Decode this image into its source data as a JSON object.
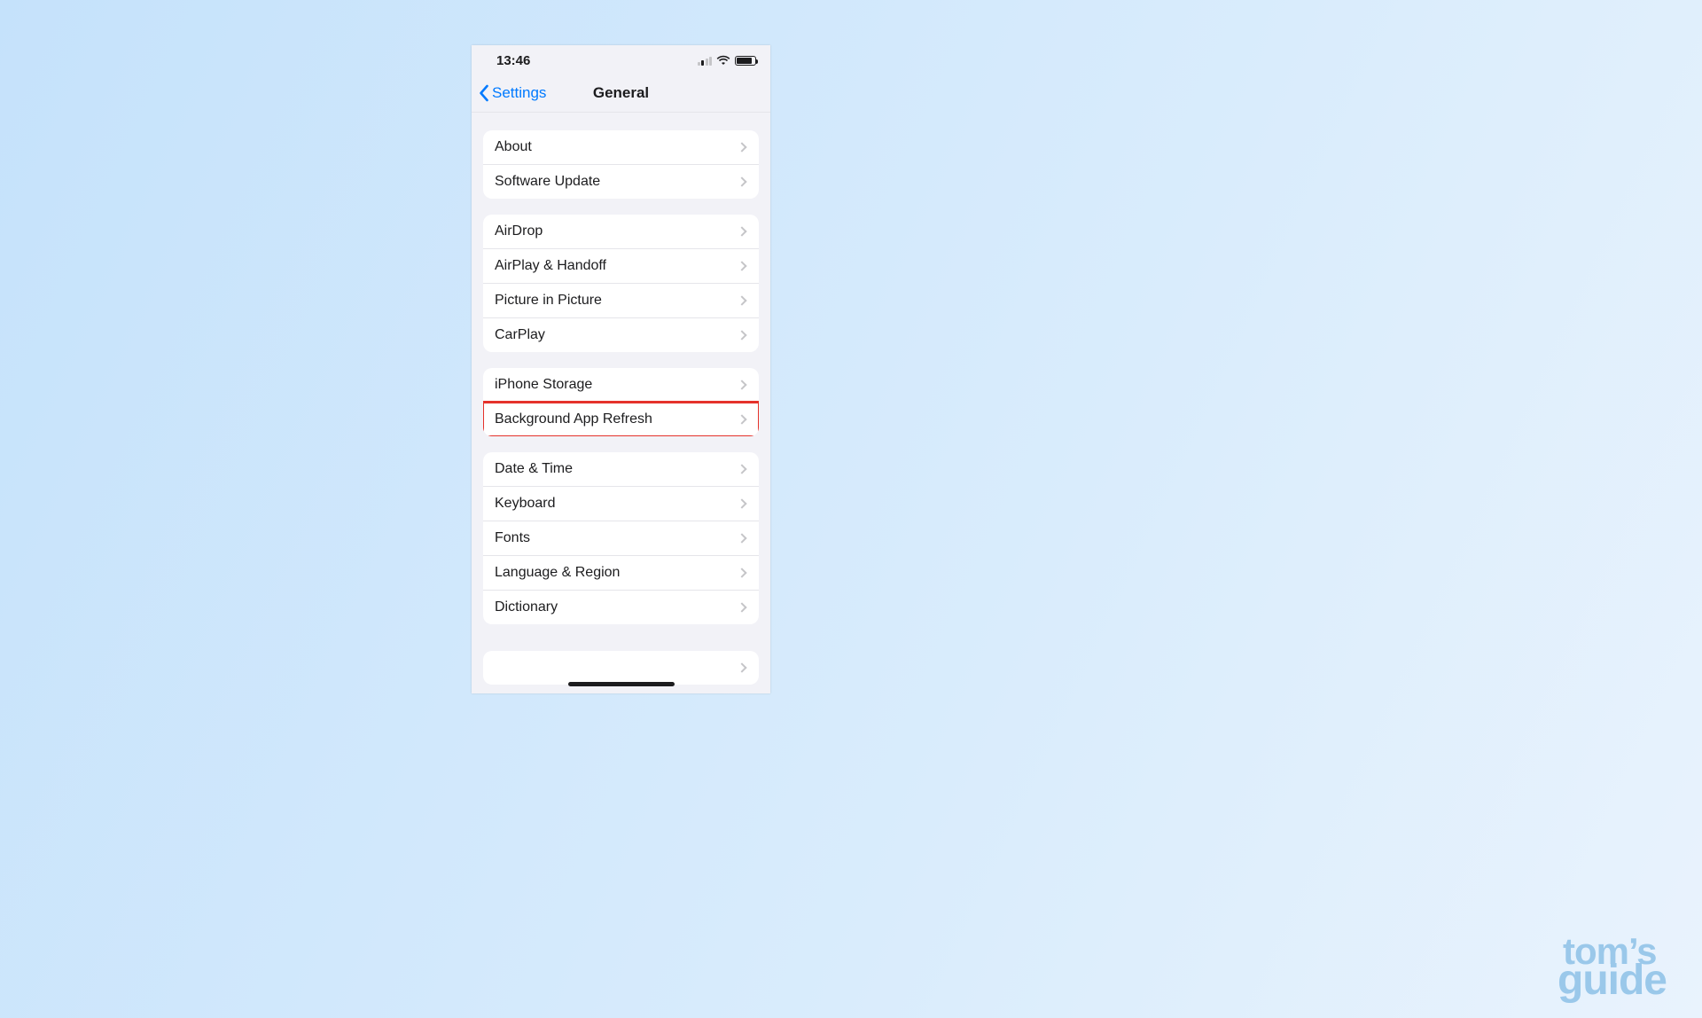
{
  "status": {
    "time": "13:46"
  },
  "nav": {
    "back_label": "Settings",
    "title": "General"
  },
  "groups": [
    {
      "rows": [
        {
          "id": "about",
          "label": "About"
        },
        {
          "id": "software-update",
          "label": "Software Update"
        }
      ]
    },
    {
      "rows": [
        {
          "id": "airdrop",
          "label": "AirDrop"
        },
        {
          "id": "airplay-handoff",
          "label": "AirPlay & Handoff"
        },
        {
          "id": "picture-in-picture",
          "label": "Picture in Picture"
        },
        {
          "id": "carplay",
          "label": "CarPlay"
        }
      ]
    },
    {
      "rows": [
        {
          "id": "iphone-storage",
          "label": "iPhone Storage"
        },
        {
          "id": "background-app-refresh",
          "label": "Background App Refresh",
          "highlighted": true
        }
      ]
    },
    {
      "rows": [
        {
          "id": "date-time",
          "label": "Date & Time"
        },
        {
          "id": "keyboard",
          "label": "Keyboard"
        },
        {
          "id": "fonts",
          "label": "Fonts"
        },
        {
          "id": "language-region",
          "label": "Language & Region"
        },
        {
          "id": "dictionary",
          "label": "Dictionary"
        }
      ]
    }
  ],
  "watermark": {
    "line1": "tom’s",
    "line2": "guide"
  }
}
